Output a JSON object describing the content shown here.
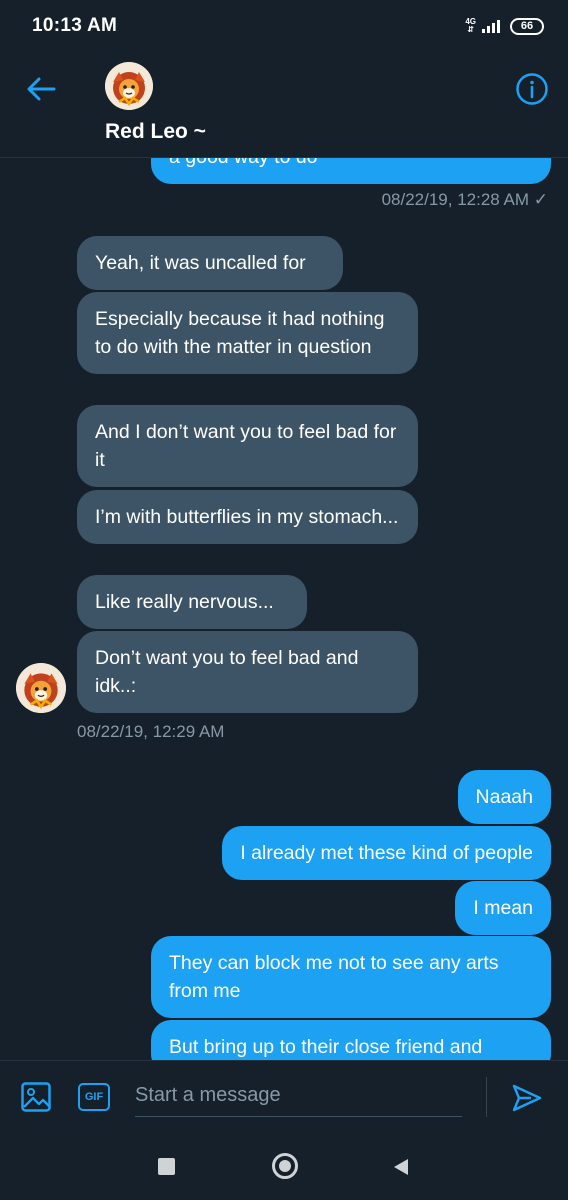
{
  "status_bar": {
    "time": "10:13 AM",
    "network": "4G",
    "battery": "66"
  },
  "header": {
    "contact_name": "Red Leo ~"
  },
  "messages": [
    {
      "side": "sent",
      "text": "a good way to do"
    },
    {
      "side": "timestamp-sent",
      "text": "08/22/19, 12:28 AM ✓"
    },
    {
      "side": "recv",
      "text": "Yeah, it was uncalled for"
    },
    {
      "side": "recv",
      "text": "Especially because it had nothing to do with the matter in question"
    },
    {
      "side": "recv",
      "text": "And I don’t want you to feel bad for it"
    },
    {
      "side": "recv",
      "text": "I’m with butterflies in my stomach..."
    },
    {
      "side": "recv",
      "text": "Like really nervous..."
    },
    {
      "side": "recv",
      "text": "Don’t want you to feel bad and idk..:"
    },
    {
      "side": "timestamp-recv",
      "text": "08/22/19, 12:29 AM"
    },
    {
      "side": "sent",
      "text": "Naaah"
    },
    {
      "side": "sent",
      "text": "I already met these kind of people"
    },
    {
      "side": "sent",
      "text": "I mean"
    },
    {
      "side": "sent",
      "text": "They can block me not to see any arts from me"
    },
    {
      "side": "sent",
      "text": "But bring up to their close friend and"
    }
  ],
  "composer": {
    "placeholder": "Start a message",
    "gif_label": "GIF"
  },
  "colors": {
    "background": "#15202b",
    "accent": "#1da1f2",
    "received_bubble": "#3d5466",
    "muted_text": "#8899a6"
  }
}
